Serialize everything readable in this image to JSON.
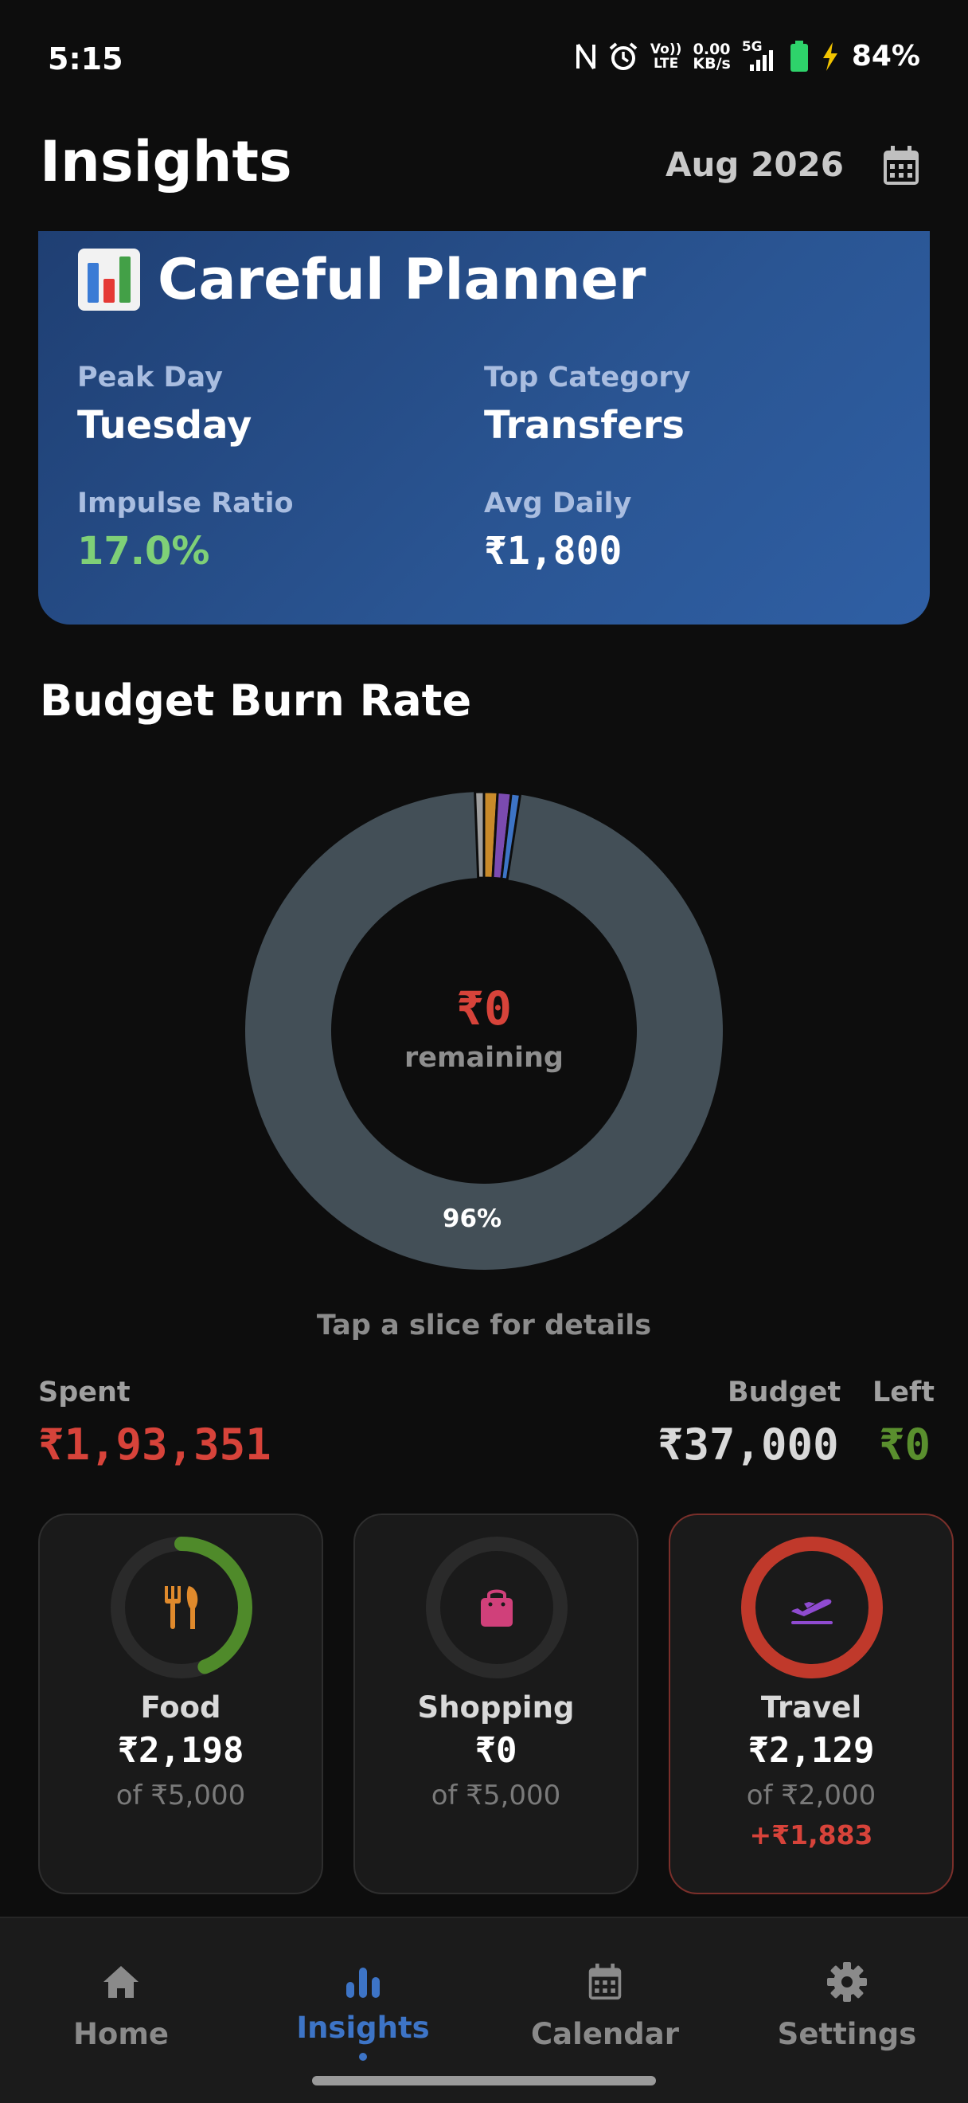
{
  "status": {
    "time": "5:15",
    "volte_top": "Vo))",
    "volte_bottom": "LTE",
    "speed_top": "0.00",
    "speed_bottom": "KB/s",
    "network": "5G",
    "battery": "84%"
  },
  "header": {
    "title": "Insights",
    "month": "Aug 2026"
  },
  "persona": {
    "title": "Careful Planner",
    "stats": [
      {
        "label": "Peak Day",
        "value": "Tuesday"
      },
      {
        "label": "Top Category",
        "value": "Transfers"
      },
      {
        "label": "Impulse Ratio",
        "value": "17.0%"
      },
      {
        "label": "Avg Daily",
        "value": "₹1,800"
      }
    ]
  },
  "burn_rate": {
    "title": "Budget Burn Rate",
    "remaining_amount": "₹0",
    "remaining_label": "remaining",
    "main_slice_percent_label": "96%",
    "hint": "Tap a slice for details",
    "slices": [
      {
        "percent": 96.0,
        "color": "#434f57"
      },
      {
        "percent": 0.6,
        "color": "#9e9e9e"
      },
      {
        "percent": 0.9,
        "color": "#c98a2a"
      },
      {
        "percent": 0.9,
        "color": "#7b4bb0"
      },
      {
        "percent": 0.6,
        "color": "#3d74c6"
      }
    ]
  },
  "summary": {
    "spent_label": "Spent",
    "spent_value": "₹1,93,351",
    "budget_label": "Budget",
    "budget_value": "₹37,000",
    "left_label": "Left",
    "left_value": "₹0",
    "colors": {
      "spent": "#d7433a",
      "budget": "#d9d9d9",
      "left": "#5a8f2e"
    }
  },
  "categories": [
    {
      "name": "Food",
      "spent": "₹2,198",
      "limit": "of ₹5,000",
      "over": "",
      "progress": 0.44,
      "ring_color": "#4f8a2a",
      "icon": "restaurant-icon",
      "icon_color": "#e08a2c"
    },
    {
      "name": "Shopping",
      "spent": "₹0",
      "limit": "of ₹5,000",
      "over": "",
      "progress": 0.0,
      "ring_color": "#4f8a2a",
      "icon": "shopping-bag-icon",
      "icon_color": "#d0407a"
    },
    {
      "name": "Travel",
      "spent": "₹2,129",
      "limit": "of ₹2,000",
      "over": "+₹1,883",
      "progress": 1.0,
      "ring_color": "#c0392b",
      "icon": "flight-takeoff-icon",
      "icon_color": "#8f4bd0"
    }
  ],
  "nav": {
    "items": [
      {
        "label": "Home",
        "icon": "home-icon"
      },
      {
        "label": "Insights",
        "icon": "insights-icon",
        "active": true
      },
      {
        "label": "Calendar",
        "icon": "calendar-icon"
      },
      {
        "label": "Settings",
        "icon": "settings-icon"
      }
    ]
  }
}
